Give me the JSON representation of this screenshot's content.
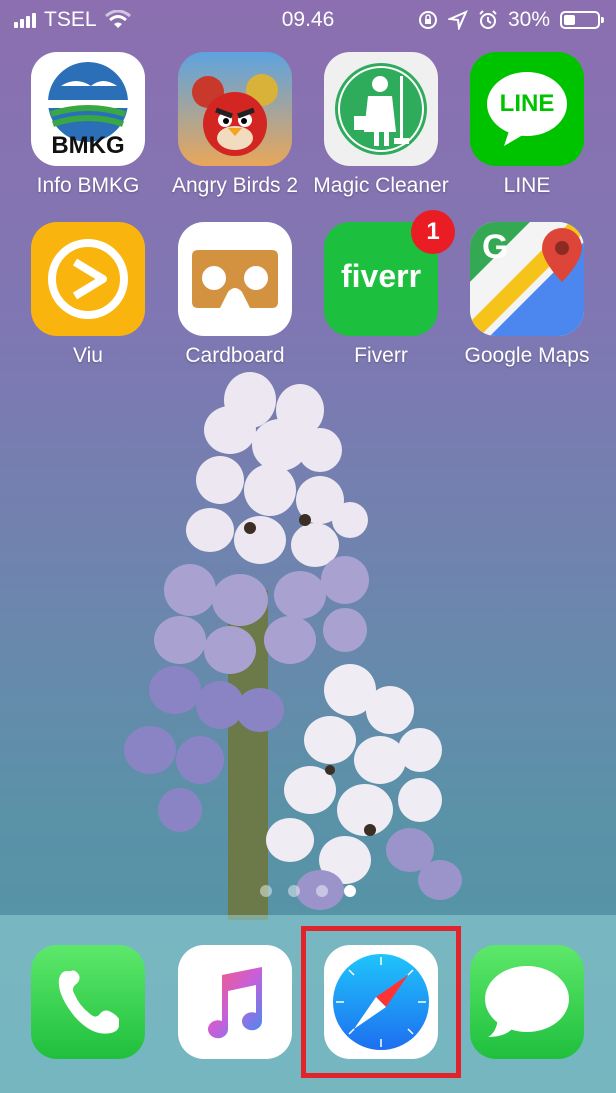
{
  "status_bar": {
    "carrier": "TSEL",
    "time": "09.46",
    "battery_percent": "30%",
    "battery_level": 0.3,
    "icons": [
      "signal-icon",
      "wifi-icon",
      "rotation-lock-icon",
      "location-icon",
      "alarm-icon",
      "battery-icon"
    ]
  },
  "home_apps": [
    {
      "label": "Info BMKG",
      "icon": "bmkg-icon"
    },
    {
      "label": "Angry Birds 2",
      "icon": "angry-birds-icon"
    },
    {
      "label": "Magic Cleaner",
      "icon": "magic-cleaner-icon"
    },
    {
      "label": "LINE",
      "icon": "line-icon",
      "icon_text": "LINE"
    },
    {
      "label": "Viu",
      "icon": "viu-icon"
    },
    {
      "label": "Cardboard",
      "icon": "cardboard-icon"
    },
    {
      "label": "Fiverr",
      "icon": "fiverr-icon",
      "icon_text": "fiverr",
      "badge": "1"
    },
    {
      "label": "Google Maps",
      "icon": "google-maps-icon",
      "icon_text": "G"
    }
  ],
  "bmkg_icon_text": "BMKG",
  "page_indicator": {
    "count": 4,
    "active_index": 3
  },
  "dock": [
    {
      "name": "Phone",
      "icon": "phone-icon"
    },
    {
      "name": "Music",
      "icon": "music-icon"
    },
    {
      "name": "Safari",
      "icon": "safari-icon",
      "highlighted": true
    },
    {
      "name": "Messages",
      "icon": "messages-icon"
    }
  ],
  "colors": {
    "highlight": "#e1242b",
    "badge": "#ea1d24"
  }
}
